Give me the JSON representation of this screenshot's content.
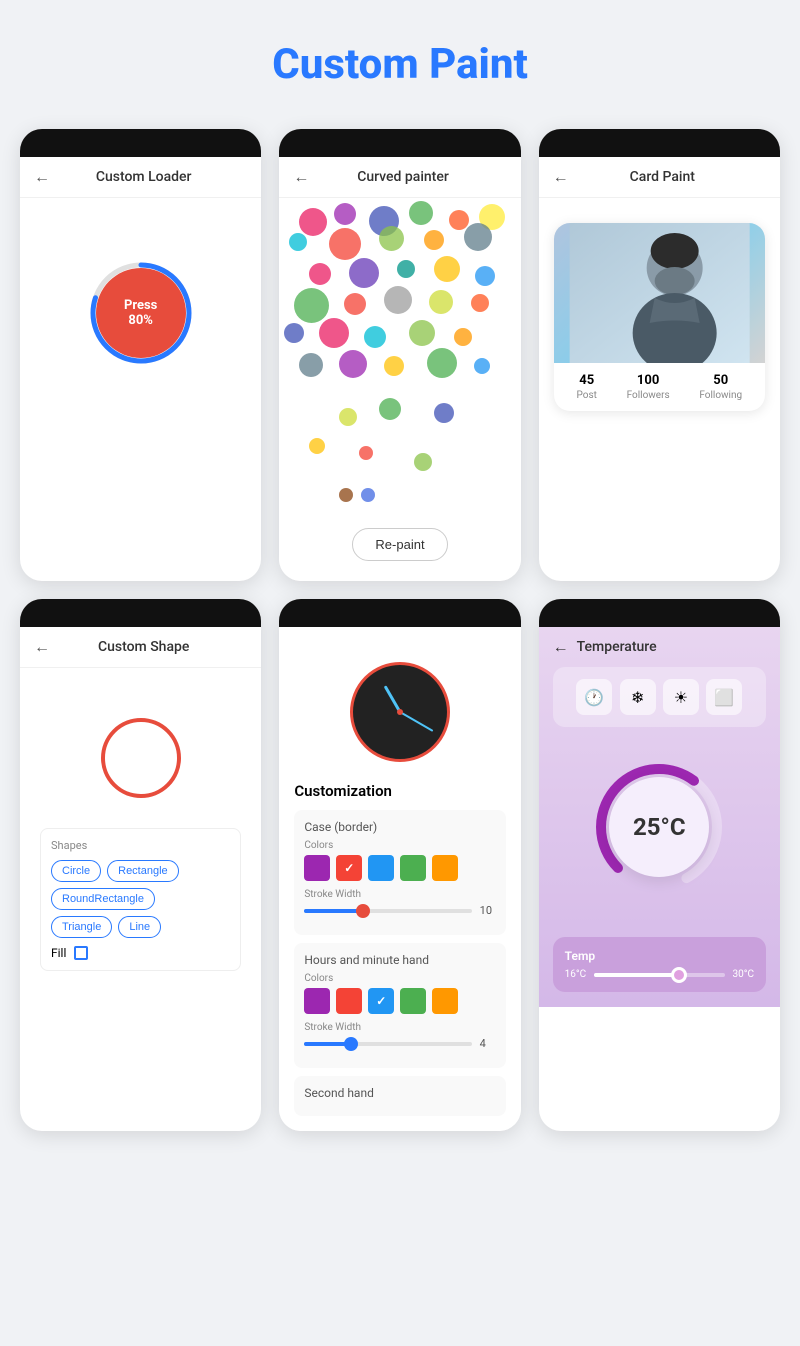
{
  "page": {
    "title_plain": "Custom",
    "title_accent": "Paint"
  },
  "phones": {
    "custom_loader": {
      "title": "Custom Loader",
      "press_label": "Press",
      "percent_label": "80%",
      "progress": 80
    },
    "curved_painter": {
      "title": "Curved painter",
      "repaint_btn": "Re-paint",
      "palette_colors": [
        "#8B4513",
        "#4169E1"
      ]
    },
    "card_paint": {
      "title": "Card Paint",
      "stats": [
        {
          "num": "45",
          "label": "Post"
        },
        {
          "num": "100",
          "label": "Followers"
        },
        {
          "num": "50",
          "label": "Following"
        }
      ]
    },
    "custom_shape": {
      "title": "Custom Shape",
      "shapes_label": "Shapes",
      "shape_buttons": [
        "Circle",
        "Rectangle",
        "RoundRectangle",
        "Triangle",
        "Line"
      ],
      "fill_label": "Fill"
    },
    "clock_customization": {
      "title": "",
      "section_title": "Customization",
      "case_label": "Case (border)",
      "colors_label": "Colors",
      "stroke_width_label": "Stroke Width",
      "stroke_val1": "10",
      "hands_label": "Hours and minute hand",
      "stroke_val2": "4",
      "second_label": "Second hand",
      "colors": [
        {
          "hex": "#9c27b0",
          "selected": false
        },
        {
          "hex": "#f44336",
          "selected": true
        },
        {
          "hex": "#2196f3",
          "selected": false
        },
        {
          "hex": "#4caf50",
          "selected": false
        },
        {
          "hex": "#ff9800",
          "selected": false
        }
      ],
      "colors2": [
        {
          "hex": "#9c27b0",
          "selected": false
        },
        {
          "hex": "#f44336",
          "selected": false
        },
        {
          "hex": "#2196f3",
          "selected": true
        },
        {
          "hex": "#4caf50",
          "selected": false
        },
        {
          "hex": "#ff9800",
          "selected": false
        }
      ]
    },
    "temperature": {
      "title": "Temperature",
      "temp_display": "25°C",
      "temp_label": "Temp",
      "temp_min": "16°C",
      "temp_max": "30°C",
      "icons": [
        "🕐",
        "❄",
        "☀",
        "⬜"
      ]
    }
  }
}
